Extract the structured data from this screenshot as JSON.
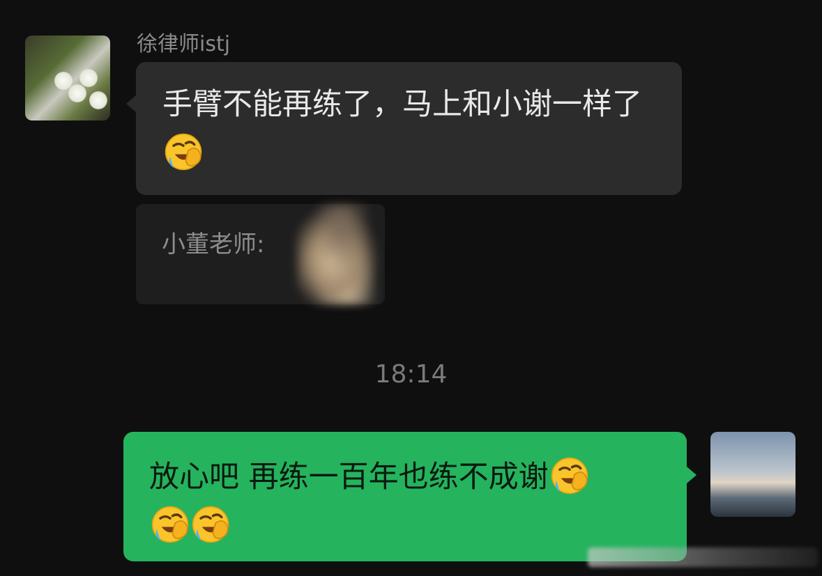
{
  "chat": {
    "messages": [
      {
        "sender": "徐律师istj",
        "direction": "incoming",
        "text": "手臂不能再练了，马上和小谢一样了",
        "emoji_count": 1,
        "emoji": "face-palm-crying-laugh-icon"
      },
      {
        "direction": "incoming-quote",
        "quote_label": "小董老师:"
      }
    ],
    "timestamp": "18:14",
    "outgoing": {
      "direction": "outgoing",
      "text": "放心吧 再练一百年也练不成谢",
      "emoji_count": 3,
      "emoji": "face-palm-crying-laugh-icon"
    }
  },
  "colors": {
    "background": "#0f0f0f",
    "incoming_bubble": "#2c2c2c",
    "outgoing_bubble": "#25b35e",
    "timestamp_text": "#7a7a7a"
  }
}
